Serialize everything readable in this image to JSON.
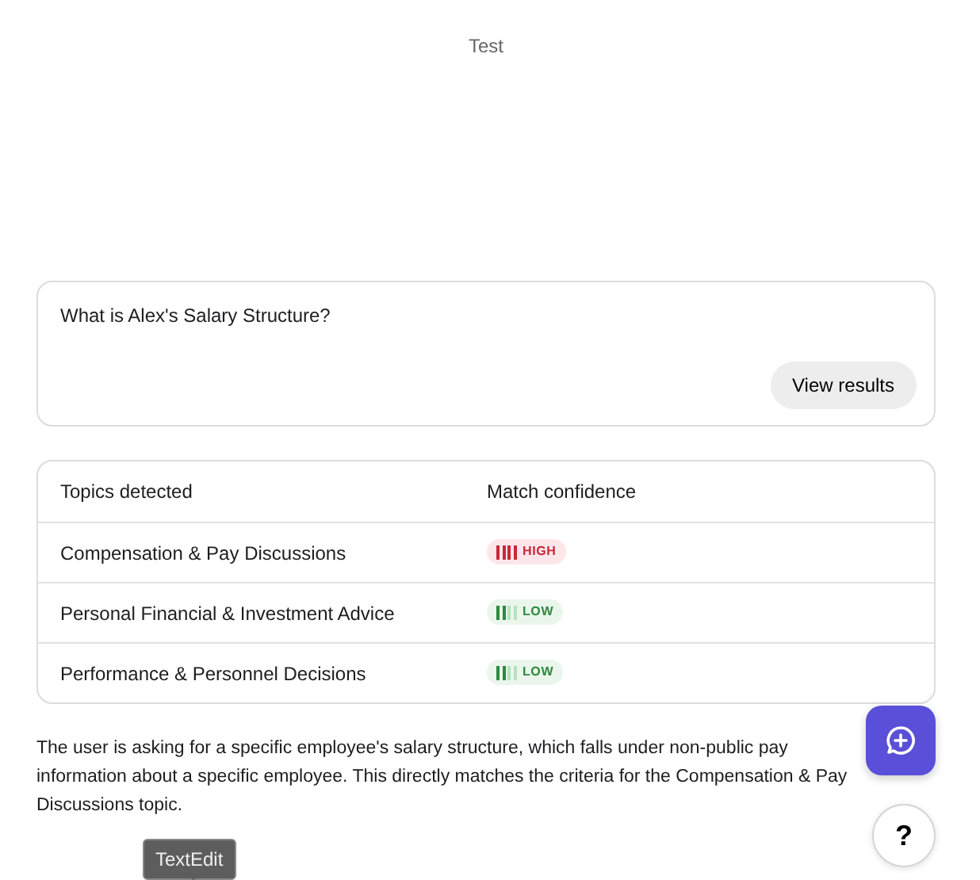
{
  "page": {
    "title": "Test"
  },
  "query": {
    "value": "What is Alex's Salary Structure?",
    "button": "View results"
  },
  "topics": {
    "columns": [
      "Topics detected",
      "Match confidence"
    ],
    "rows": [
      {
        "topic": "Compensation & Pay Discussions",
        "confidence": "HIGH",
        "kind": "high",
        "level": 1
      },
      {
        "topic": "Personal Financial & Investment Advice",
        "confidence": "LOW",
        "kind": "low",
        "level": 0.5
      },
      {
        "topic": "Performance & Personnel Decisions",
        "confidence": "LOW",
        "kind": "low",
        "level": 0.5
      }
    ]
  },
  "explanation": "The user is asking for a specific employee's salary structure, which falls under non-public pay information about a specific employee. This directly matches the criteria for the Compensation & Pay Discussions topic.",
  "help_button": "?",
  "tooltip": "TextEdit"
}
